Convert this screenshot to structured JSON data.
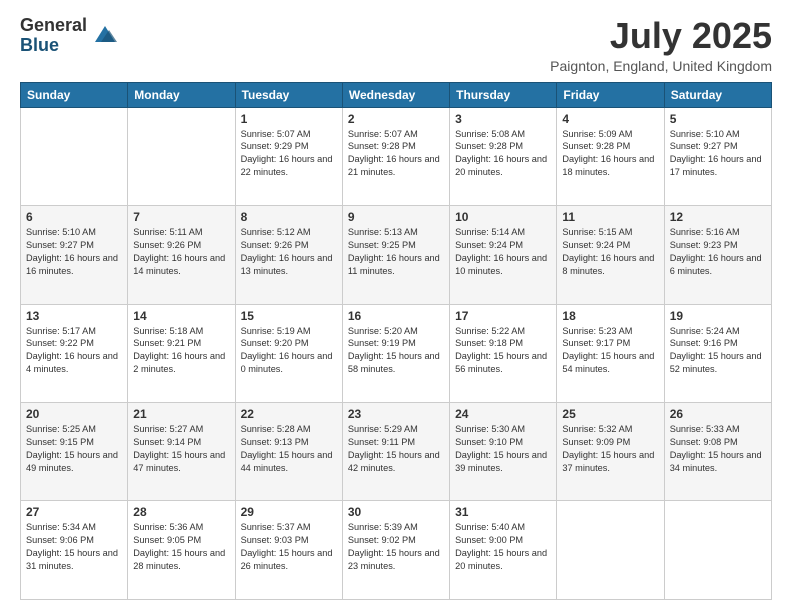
{
  "logo": {
    "general": "General",
    "blue": "Blue"
  },
  "title": "July 2025",
  "location": "Paignton, England, United Kingdom",
  "days_of_week": [
    "Sunday",
    "Monday",
    "Tuesday",
    "Wednesday",
    "Thursday",
    "Friday",
    "Saturday"
  ],
  "weeks": [
    [
      {
        "day": "",
        "info": ""
      },
      {
        "day": "",
        "info": ""
      },
      {
        "day": "1",
        "info": "Sunrise: 5:07 AM\nSunset: 9:29 PM\nDaylight: 16 hours and 22 minutes."
      },
      {
        "day": "2",
        "info": "Sunrise: 5:07 AM\nSunset: 9:28 PM\nDaylight: 16 hours and 21 minutes."
      },
      {
        "day": "3",
        "info": "Sunrise: 5:08 AM\nSunset: 9:28 PM\nDaylight: 16 hours and 20 minutes."
      },
      {
        "day": "4",
        "info": "Sunrise: 5:09 AM\nSunset: 9:28 PM\nDaylight: 16 hours and 18 minutes."
      },
      {
        "day": "5",
        "info": "Sunrise: 5:10 AM\nSunset: 9:27 PM\nDaylight: 16 hours and 17 minutes."
      }
    ],
    [
      {
        "day": "6",
        "info": "Sunrise: 5:10 AM\nSunset: 9:27 PM\nDaylight: 16 hours and 16 minutes."
      },
      {
        "day": "7",
        "info": "Sunrise: 5:11 AM\nSunset: 9:26 PM\nDaylight: 16 hours and 14 minutes."
      },
      {
        "day": "8",
        "info": "Sunrise: 5:12 AM\nSunset: 9:26 PM\nDaylight: 16 hours and 13 minutes."
      },
      {
        "day": "9",
        "info": "Sunrise: 5:13 AM\nSunset: 9:25 PM\nDaylight: 16 hours and 11 minutes."
      },
      {
        "day": "10",
        "info": "Sunrise: 5:14 AM\nSunset: 9:24 PM\nDaylight: 16 hours and 10 minutes."
      },
      {
        "day": "11",
        "info": "Sunrise: 5:15 AM\nSunset: 9:24 PM\nDaylight: 16 hours and 8 minutes."
      },
      {
        "day": "12",
        "info": "Sunrise: 5:16 AM\nSunset: 9:23 PM\nDaylight: 16 hours and 6 minutes."
      }
    ],
    [
      {
        "day": "13",
        "info": "Sunrise: 5:17 AM\nSunset: 9:22 PM\nDaylight: 16 hours and 4 minutes."
      },
      {
        "day": "14",
        "info": "Sunrise: 5:18 AM\nSunset: 9:21 PM\nDaylight: 16 hours and 2 minutes."
      },
      {
        "day": "15",
        "info": "Sunrise: 5:19 AM\nSunset: 9:20 PM\nDaylight: 16 hours and 0 minutes."
      },
      {
        "day": "16",
        "info": "Sunrise: 5:20 AM\nSunset: 9:19 PM\nDaylight: 15 hours and 58 minutes."
      },
      {
        "day": "17",
        "info": "Sunrise: 5:22 AM\nSunset: 9:18 PM\nDaylight: 15 hours and 56 minutes."
      },
      {
        "day": "18",
        "info": "Sunrise: 5:23 AM\nSunset: 9:17 PM\nDaylight: 15 hours and 54 minutes."
      },
      {
        "day": "19",
        "info": "Sunrise: 5:24 AM\nSunset: 9:16 PM\nDaylight: 15 hours and 52 minutes."
      }
    ],
    [
      {
        "day": "20",
        "info": "Sunrise: 5:25 AM\nSunset: 9:15 PM\nDaylight: 15 hours and 49 minutes."
      },
      {
        "day": "21",
        "info": "Sunrise: 5:27 AM\nSunset: 9:14 PM\nDaylight: 15 hours and 47 minutes."
      },
      {
        "day": "22",
        "info": "Sunrise: 5:28 AM\nSunset: 9:13 PM\nDaylight: 15 hours and 44 minutes."
      },
      {
        "day": "23",
        "info": "Sunrise: 5:29 AM\nSunset: 9:11 PM\nDaylight: 15 hours and 42 minutes."
      },
      {
        "day": "24",
        "info": "Sunrise: 5:30 AM\nSunset: 9:10 PM\nDaylight: 15 hours and 39 minutes."
      },
      {
        "day": "25",
        "info": "Sunrise: 5:32 AM\nSunset: 9:09 PM\nDaylight: 15 hours and 37 minutes."
      },
      {
        "day": "26",
        "info": "Sunrise: 5:33 AM\nSunset: 9:08 PM\nDaylight: 15 hours and 34 minutes."
      }
    ],
    [
      {
        "day": "27",
        "info": "Sunrise: 5:34 AM\nSunset: 9:06 PM\nDaylight: 15 hours and 31 minutes."
      },
      {
        "day": "28",
        "info": "Sunrise: 5:36 AM\nSunset: 9:05 PM\nDaylight: 15 hours and 28 minutes."
      },
      {
        "day": "29",
        "info": "Sunrise: 5:37 AM\nSunset: 9:03 PM\nDaylight: 15 hours and 26 minutes."
      },
      {
        "day": "30",
        "info": "Sunrise: 5:39 AM\nSunset: 9:02 PM\nDaylight: 15 hours and 23 minutes."
      },
      {
        "day": "31",
        "info": "Sunrise: 5:40 AM\nSunset: 9:00 PM\nDaylight: 15 hours and 20 minutes."
      },
      {
        "day": "",
        "info": ""
      },
      {
        "day": "",
        "info": ""
      }
    ]
  ]
}
